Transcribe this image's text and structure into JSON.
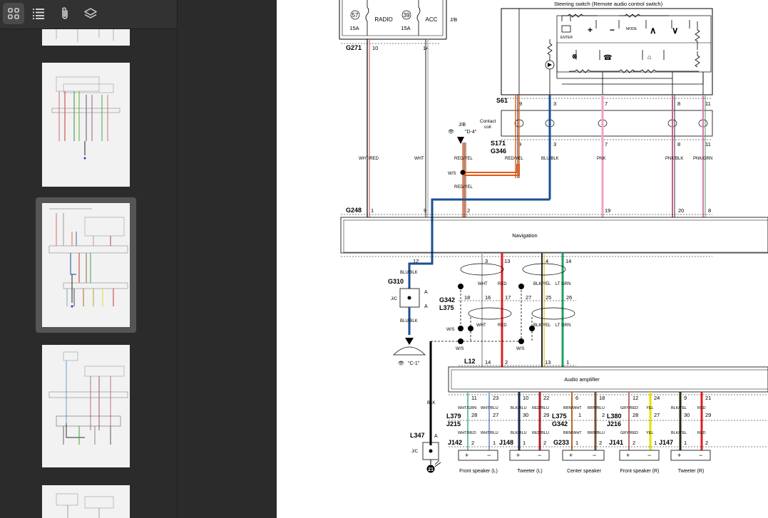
{
  "toolbar": {
    "icons": [
      "thumbnails-icon",
      "outline-icon",
      "attachments-icon",
      "layers-icon"
    ],
    "active": "thumbnails-icon"
  },
  "sidebar": {
    "selected_page_index": 2
  },
  "diagram": {
    "fuses": [
      {
        "num": "57",
        "amp": "15A",
        "name": "RADIO"
      },
      {
        "num": "39",
        "amp": "15A",
        "name": "ACC"
      }
    ],
    "jb_label": "J/B",
    "steering_switch_title": "Steering switch (Remote audio control switch)",
    "switch_labels": {
      "enter": "ENTER",
      "mode": "MODE"
    },
    "connectors": {
      "g271": "G271",
      "s61": "S61",
      "s171": "S171",
      "g346": "G346",
      "g248": "G248",
      "g310": "G310",
      "g342": "G342",
      "l375": "L375",
      "l12": "L12",
      "l347": "L347",
      "l379": "L379",
      "j215": "J215",
      "l375b": "L375",
      "g342b": "G342",
      "l380": "L380",
      "j216": "J216",
      "j142": "J142",
      "j148": "J148",
      "g233": "G233",
      "j141": "J141",
      "j147": "J147"
    },
    "g271_pins": [
      "10",
      "14"
    ],
    "s61_pins": [
      "9",
      "3",
      "7",
      "8",
      "11"
    ],
    "s171_pins": [
      "9",
      "3",
      "7",
      "8",
      "11"
    ],
    "contact_coil": [
      "Contact",
      "coil"
    ],
    "jb_ref": {
      "label": "J/B",
      "ref": "\"D-4\"",
      "num": "D"
    },
    "wire_colors_upper": [
      "WHT/RED",
      "WHT",
      "RED/YEL",
      "RED/YEL",
      "BLU/BLK",
      "PNK",
      "PNK/BLK",
      "PNK/GRN"
    ],
    "ws": "W/S",
    "red_yel": "RED/YEL",
    "g248_pins": [
      "1",
      "9",
      "2",
      "19",
      "20",
      "8"
    ],
    "navigation_label": "Navigation",
    "nav_bottom_pins": [
      "12",
      "3",
      "13",
      "4",
      "14"
    ],
    "blu_blk": "BLU/BLK",
    "jc_label": "J/C",
    "a_label": "A",
    "c1_ref": "\"C-1\"",
    "ground_num": "B",
    "ground_num2": "21",
    "mid_wire_colors": [
      "WHT",
      "RED",
      "BLK/YEL",
      "LT GRN"
    ],
    "g342_pins": [
      "18",
      "16",
      "17",
      "27",
      "25",
      "26"
    ],
    "blk_label": "BLK",
    "l12_pins": [
      "14",
      "2",
      "13",
      "1"
    ],
    "amp_label": "Audio amplifier",
    "amp_pins": [
      "11",
      "23",
      "10",
      "22",
      "6",
      "18",
      "12",
      "24",
      "9",
      "21"
    ],
    "amp_wire_colors": [
      "WHT/GRN",
      "WHT/BLU",
      "BLK/BLU",
      "RED/BLU",
      "BRN/WHT",
      "BRN/BLU",
      "GRY/RED",
      "YEL",
      "BLK/YEL",
      "RED"
    ],
    "mid_pins2": [
      "28",
      "27",
      "30",
      "29",
      "1",
      "2",
      "28",
      "27",
      "30",
      "29"
    ],
    "lower_wire_colors": [
      "WHT/RED",
      "WHT/BLU",
      "BLK/BLU",
      "RED/BLU",
      "BRN/WHT",
      "BRN/BLU",
      "GRY/RED",
      "YEL",
      "BLK/YEL",
      "RED"
    ],
    "speaker_pins": [
      "2",
      "1",
      "1",
      "2",
      "1",
      "2",
      "2",
      "1",
      "1",
      "2"
    ],
    "speakers": [
      "Front speaker (L)",
      "Tweeter (L)",
      "Center speaker",
      "Front speaker (R)",
      "Tweeter (R)"
    ],
    "plus": "+",
    "minus": "−"
  }
}
